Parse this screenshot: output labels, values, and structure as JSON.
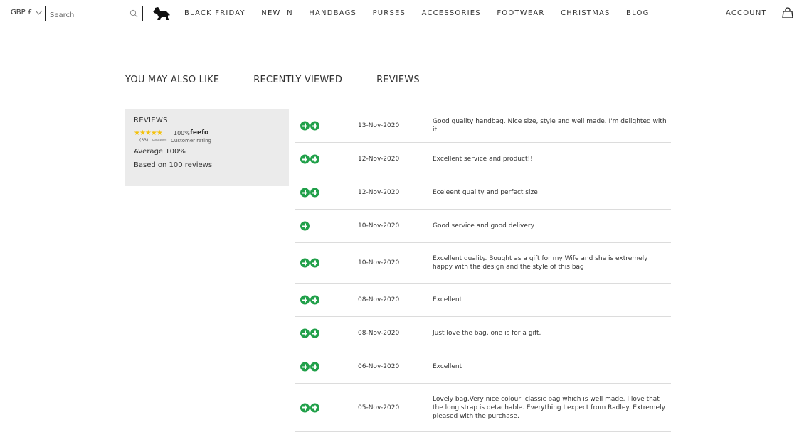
{
  "header": {
    "currency": "GBP £",
    "search_placeholder": "Search",
    "nav": [
      "BLACK FRIDAY",
      "NEW IN",
      "HANDBAGS",
      "PURSES",
      "ACCESSORIES",
      "FOOTWEAR",
      "CHRISTMAS",
      "BLOG"
    ],
    "account": "ACCOUNT"
  },
  "tabs": [
    "YOU MAY ALSO LIKE",
    "RECENTLY VIEWED",
    "REVIEWS"
  ],
  "summary": {
    "title": "REVIEWS",
    "feefo": {
      "stars": "★★★★★",
      "percent": "100%",
      "brand": "feefo",
      "count": "(33)",
      "reviews_word": "Reviews",
      "customer_rating": "Customer rating"
    },
    "average": "Average 100%",
    "based_on": "Based on 100 reviews"
  },
  "reviews": [
    {
      "rating": 2,
      "date": "13-Nov-2020",
      "text": "Good quality handbag. Nice size, style and well made. I'm delighted with it"
    },
    {
      "rating": 2,
      "date": "12-Nov-2020",
      "text": "Excellent service and product!!"
    },
    {
      "rating": 2,
      "date": "12-Nov-2020",
      "text": "Eceleent quality and perfect size"
    },
    {
      "rating": 1,
      "date": "10-Nov-2020",
      "text": "Good service and good delivery"
    },
    {
      "rating": 2,
      "date": "10-Nov-2020",
      "text": "Excellent quality. Bought as a gift for my Wife and she is extremely happy with the design and the style of this bag"
    },
    {
      "rating": 2,
      "date": "08-Nov-2020",
      "text": "Excellent"
    },
    {
      "rating": 2,
      "date": "08-Nov-2020",
      "text": "Just love the bag, one is for a gift."
    },
    {
      "rating": 2,
      "date": "06-Nov-2020",
      "text": "Excellent"
    },
    {
      "rating": 2,
      "date": "05-Nov-2020",
      "text": "Lovely bag.Very nice colour, classic bag which is well made. I love that the long strap is detachable. Everything I expect from Radley. Extremely pleased with the purchase."
    }
  ],
  "colors": {
    "rating_icon": "#21a04a",
    "panel_bg": "#ebebeb",
    "star": "#f4c20d"
  }
}
